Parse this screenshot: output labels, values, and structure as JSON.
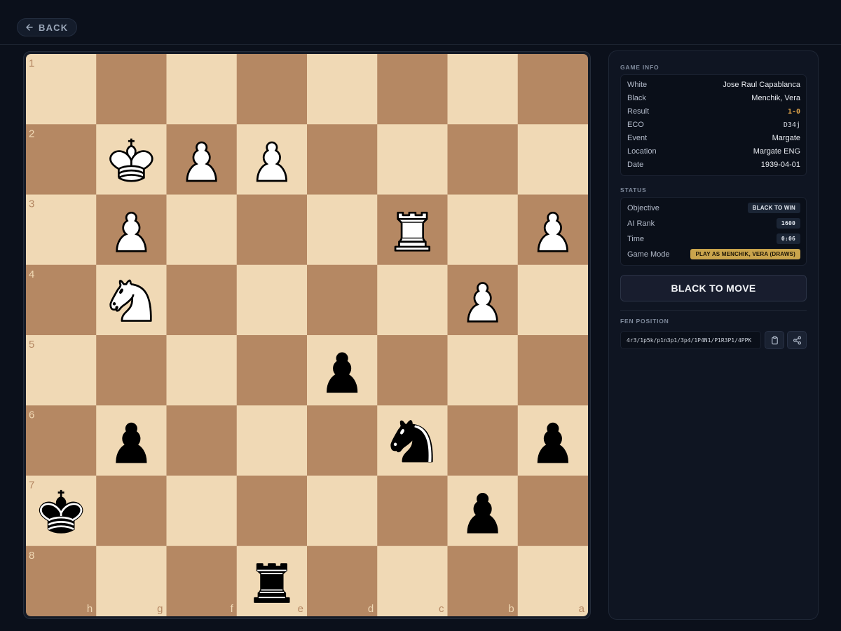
{
  "header": {
    "back_label": "BACK",
    "back_icon": "arrow-left-icon"
  },
  "board": {
    "light_color": "#f0d9b5",
    "dark_color": "#b58863",
    "rank_labels": [
      "1",
      "2",
      "3",
      "4",
      "5",
      "6",
      "7",
      "8"
    ],
    "file_labels": [
      "h",
      "g",
      "f",
      "e",
      "d",
      "c",
      "b",
      "a"
    ],
    "pieces": [
      {
        "type": "K",
        "color": "white",
        "square": "g2"
      },
      {
        "type": "P",
        "color": "white",
        "square": "f2"
      },
      {
        "type": "P",
        "color": "white",
        "square": "e2"
      },
      {
        "type": "P",
        "color": "white",
        "square": "g3"
      },
      {
        "type": "R",
        "color": "white",
        "square": "c3"
      },
      {
        "type": "P",
        "color": "white",
        "square": "a3"
      },
      {
        "type": "N",
        "color": "white",
        "square": "g4"
      },
      {
        "type": "P",
        "color": "white",
        "square": "b4"
      },
      {
        "type": "P",
        "color": "black",
        "square": "d5"
      },
      {
        "type": "P",
        "color": "black",
        "square": "g6"
      },
      {
        "type": "N",
        "color": "black",
        "square": "c6"
      },
      {
        "type": "P",
        "color": "black",
        "square": "a6"
      },
      {
        "type": "K",
        "color": "black",
        "square": "h7"
      },
      {
        "type": "P",
        "color": "black",
        "square": "b7"
      },
      {
        "type": "R",
        "color": "black",
        "square": "e8"
      }
    ]
  },
  "game_info": {
    "title": "GAME INFO",
    "rows": [
      {
        "label": "White",
        "value": "Jose Raul Capablanca"
      },
      {
        "label": "Black",
        "value": "Menchik, Vera"
      },
      {
        "label": "Result",
        "value": "1-0"
      },
      {
        "label": "ECO",
        "value": "D34j"
      },
      {
        "label": "Event",
        "value": "Margate"
      },
      {
        "label": "Location",
        "value": "Margate ENG"
      },
      {
        "label": "Date",
        "value": "1939-04-01"
      }
    ]
  },
  "status": {
    "title": "STATUS",
    "objective_label": "Objective",
    "objective_value": "BLACK TO WIN",
    "ai_rank_label": "AI Rank",
    "ai_rank_value": "1600",
    "time_label": "Time",
    "time_value": "0:06",
    "mode_label": "Game Mode",
    "mode_value": "PLAY AS MENCHIK, VERA (DRAWS)"
  },
  "turn": {
    "label": "BLACK TO MOVE"
  },
  "fen": {
    "title": "FEN POSITION",
    "value": "4r3/1p5k/p1n3p1/3p4/1P4N1/P1R3P1/4PPK",
    "copy_icon": "clipboard-icon",
    "share_icon": "share-icon"
  }
}
